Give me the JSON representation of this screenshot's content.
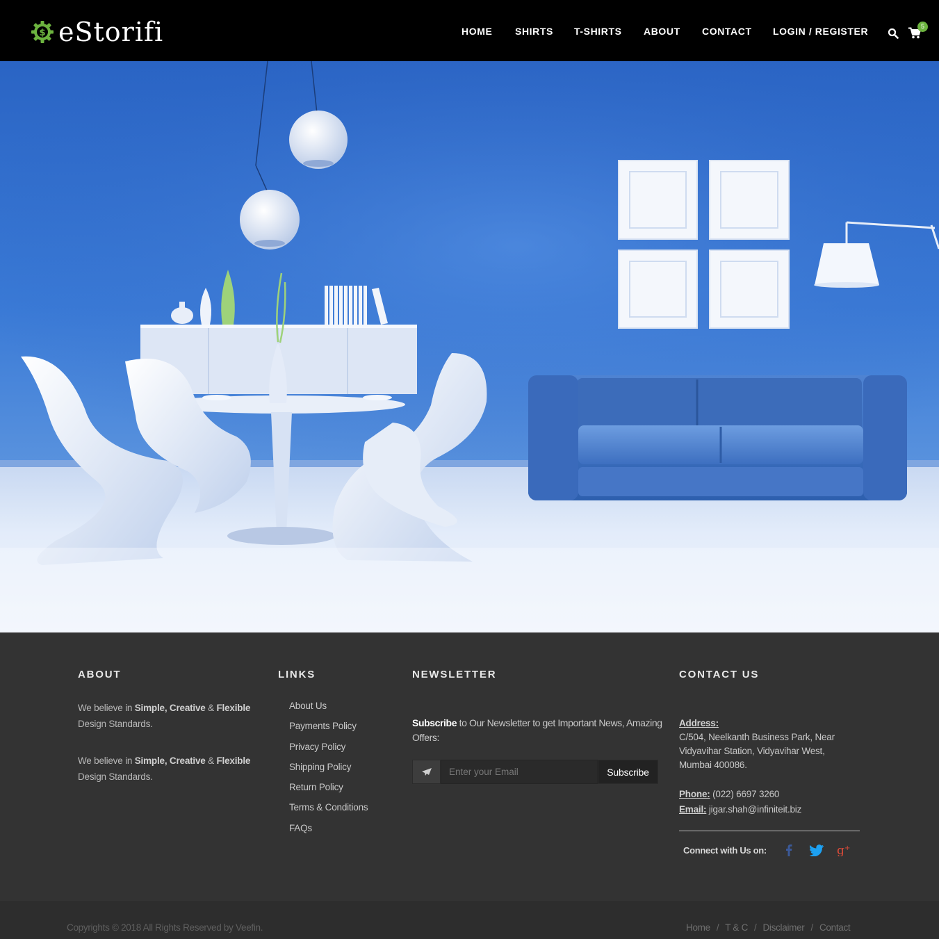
{
  "brand": {
    "name": "eStorifi",
    "accent": "#6cb33f"
  },
  "nav": {
    "items": [
      "HOME",
      "SHIRTS",
      "T-SHIRTS",
      "ABOUT",
      "CONTACT",
      "LOGIN / REGISTER"
    ],
    "cart_count": "5"
  },
  "icons": {
    "logo": "dollar-gear-icon",
    "search": "search-icon",
    "cart": "shopping-cart-icon",
    "newsletter": "paper-plane-icon",
    "facebook": "facebook-icon",
    "twitter": "twitter-icon",
    "google_plus": "google-plus-icon"
  },
  "footer": {
    "about": {
      "title": "ABOUT",
      "paragraphs": [
        {
          "pre": "We believe in ",
          "bold": "Simple, Creative",
          "mid": " & ",
          "bold2": "Flexible",
          "post": " Design Standards."
        },
        {
          "pre": "We believe in ",
          "bold": "Simple, Creative",
          "mid": " & ",
          "bold2": "Flexible",
          "post": " Design Standards."
        }
      ]
    },
    "links": {
      "title": "LINKS",
      "items": [
        "About Us",
        "Payments Policy",
        "Privacy Policy",
        "Shipping Policy",
        "Return Policy",
        "Terms & Conditions",
        "FAQs"
      ]
    },
    "newsletter": {
      "title": "NEWSLETTER",
      "lead_bold": "Subscribe",
      "lead_rest": " to Our Newsletter to get Important News, Amazing Offers:",
      "placeholder": "Enter your Email",
      "button": "Subscribe"
    },
    "contact": {
      "title": "CONTACT US",
      "address_label": "Address:",
      "address_lines": [
        "C/504, Neelkanth Business Park, Near",
        "Vidyavihar Station, Vidyavihar West,",
        "Mumbai 400086."
      ],
      "phone_label": "Phone:",
      "phone": " (022) 6697 3260",
      "email_label": "Email:",
      "email": " jigar.shah@infiniteit.biz",
      "connect_label": "Connect with Us on:"
    }
  },
  "bottom_bar": {
    "copyright": "Copyrights © 2018 All Rights Reserved by Veefin.",
    "links": [
      "Home",
      "T & C",
      "Disclaimer",
      "Contact"
    ],
    "separator": "/"
  },
  "colors": {
    "header_bg": "#000000",
    "footer_bg": "#333333",
    "bottom_bg": "#2d2d2d",
    "facebook": "#3b5998",
    "twitter": "#1da1f2",
    "google_plus": "#dd4b39"
  }
}
